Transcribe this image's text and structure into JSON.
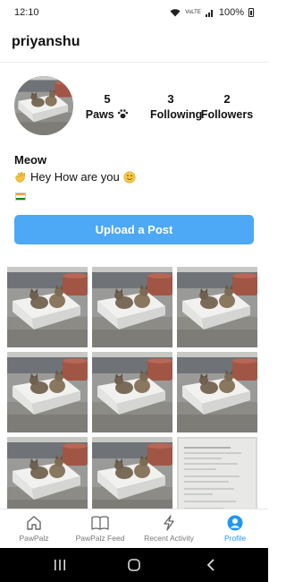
{
  "status": {
    "time": "12:10",
    "network": "VoLTE",
    "battery": "100%"
  },
  "header": {
    "username": "priyanshu"
  },
  "profile": {
    "stats": [
      {
        "value": "5",
        "label": "Paws"
      },
      {
        "value": "3",
        "label": "Following"
      },
      {
        "value": "2",
        "label": "Followers"
      }
    ],
    "bio_name": "Meow",
    "bio_text": "Hey How are you",
    "bio_emojis": [
      "waving-hand",
      "smiling-face"
    ],
    "flag": "india-flag",
    "upload_label": "Upload a Post"
  },
  "grid": {
    "tiles": [
      "cat-photo",
      "cat-photo",
      "cat-photo",
      "cat-photo",
      "cat-photo",
      "cat-photo",
      "cat-photo",
      "cat-photo",
      "document-photo"
    ]
  },
  "bottom_nav": {
    "items": [
      {
        "label": "PawPalz",
        "icon": "home-icon"
      },
      {
        "label": "PawPalz Feed",
        "icon": "book-icon"
      },
      {
        "label": "Recent Activity",
        "icon": "lightning-icon"
      },
      {
        "label": "Profile",
        "icon": "profile-icon",
        "active": true
      }
    ]
  },
  "colors": {
    "accent": "#2196f3",
    "button": "#4da8f5"
  }
}
